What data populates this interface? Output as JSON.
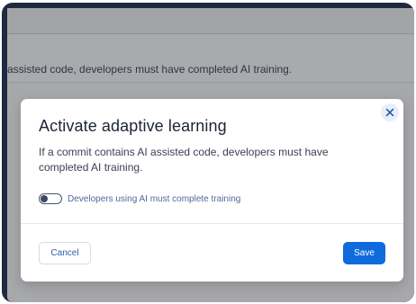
{
  "background": {
    "description_text": "assisted code, developers must have completed AI training."
  },
  "modal": {
    "title": "Activate adaptive learning",
    "description": "If a commit contains AI assisted code, developers must have completed AI training.",
    "close_icon": "close-icon",
    "toggle": {
      "label": "Developers using AI must complete training",
      "checked": false
    },
    "cancel_label": "Cancel",
    "save_label": "Save"
  },
  "colors": {
    "primary": "#0d6bdc",
    "link": "#2d5fb0",
    "overlay": "#a7a8ab",
    "frame": "#1f2a40"
  }
}
